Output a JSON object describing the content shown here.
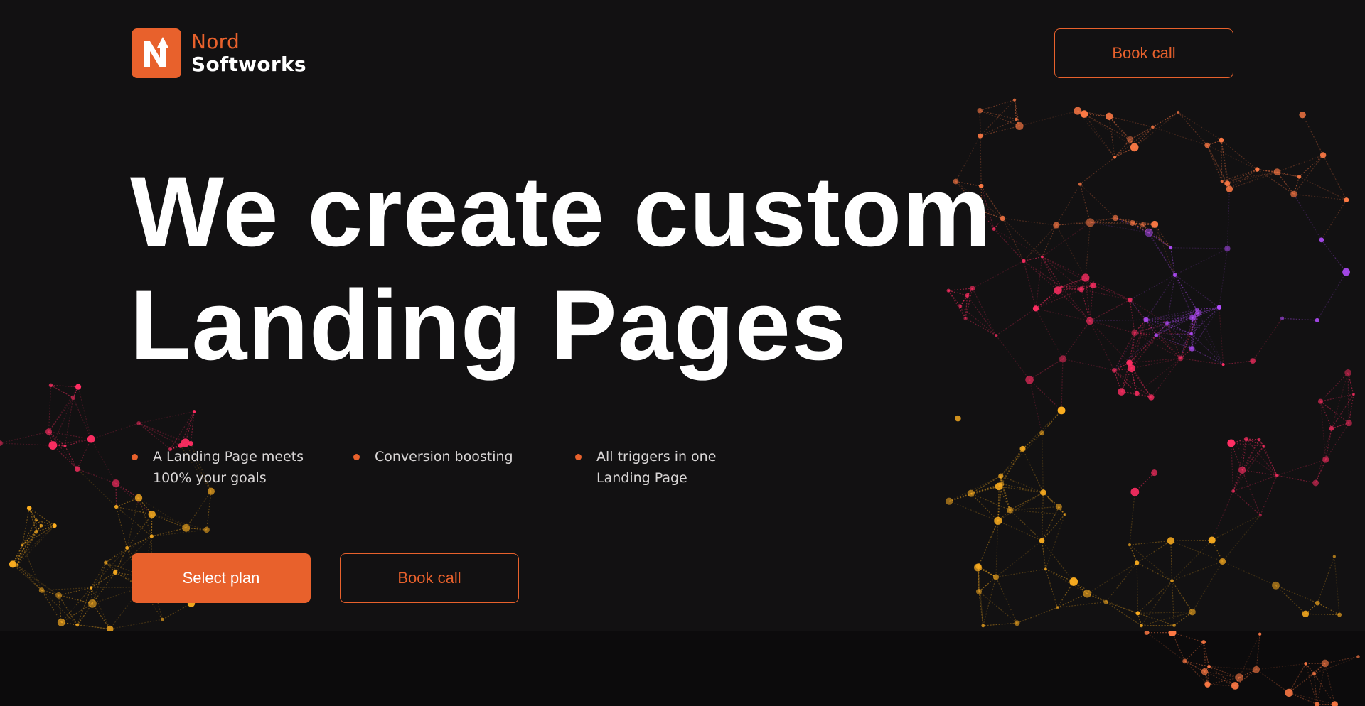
{
  "brand": {
    "name_line1": "Nord",
    "name_line2": "Softworks",
    "logo_icon": "n-arrow-up-logo-icon",
    "accent_color": "#e8612c",
    "background_color": "#121112"
  },
  "header": {
    "book_call_label": "Book call"
  },
  "hero": {
    "headline_line1": "We create custom",
    "headline_line2": "Landing Pages",
    "features": [
      {
        "text": "A Landing Page meets 100% your goals"
      },
      {
        "text": "Conversion boosting"
      },
      {
        "text": "All triggers in one Landing Page"
      }
    ],
    "primary_cta_label": "Select plan",
    "secondary_cta_label": "Book call"
  },
  "decor": {
    "network_colors": [
      "#ff7a45",
      "#b44dff",
      "#ff2e63",
      "#ffb020",
      "#e8612c"
    ]
  }
}
